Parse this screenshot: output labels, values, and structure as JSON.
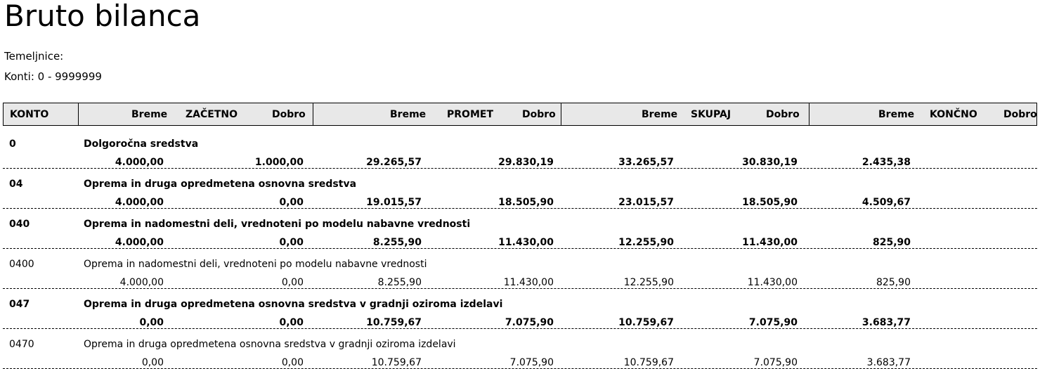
{
  "page": {
    "title": "Bruto bilanca",
    "temeljnice": "Temeljnice:",
    "konti": "Konti: 0 - 9999999"
  },
  "header": {
    "konto": "KONTO",
    "zacetno": {
      "breme": "Breme",
      "label": "ZAČETNO",
      "dobro": "Dobro"
    },
    "promet": {
      "breme": "Breme",
      "label": "PROMET",
      "dobro": "Dobro"
    },
    "skupaj": {
      "breme": "Breme",
      "label": "SKUPAJ",
      "dobro": "Dobro"
    },
    "koncno": {
      "breme": "Breme",
      "label": "KONČNO",
      "dobro": "Dobro"
    }
  },
  "rows": [
    {
      "konto": "0",
      "naziv": "Dolgoročna sredstva",
      "bold": true,
      "zacetno_breme": "4.000,00",
      "zacetno_dobro": "1.000,00",
      "promet_breme": "29.265,57",
      "promet_dobro": "29.830,19",
      "skupaj_breme": "33.265,57",
      "skupaj_dobro": "30.830,19",
      "koncno_breme": "2.435,38",
      "koncno_dobro": ""
    },
    {
      "konto": "04",
      "naziv": "Oprema in druga opredmetena osnovna sredstva",
      "bold": true,
      "zacetno_breme": "4.000,00",
      "zacetno_dobro": "0,00",
      "promet_breme": "19.015,57",
      "promet_dobro": "18.505,90",
      "skupaj_breme": "23.015,57",
      "skupaj_dobro": "18.505,90",
      "koncno_breme": "4.509,67",
      "koncno_dobro": ""
    },
    {
      "konto": "040",
      "naziv": "Oprema in nadomestni deli, vrednoteni po modelu nabavne vrednosti",
      "bold": true,
      "zacetno_breme": "4.000,00",
      "zacetno_dobro": "0,00",
      "promet_breme": "8.255,90",
      "promet_dobro": "11.430,00",
      "skupaj_breme": "12.255,90",
      "skupaj_dobro": "11.430,00",
      "koncno_breme": "825,90",
      "koncno_dobro": ""
    },
    {
      "konto": "0400",
      "naziv": "Oprema in nadomestni deli, vrednoteni po modelu nabavne vrednosti",
      "bold": false,
      "zacetno_breme": "4.000,00",
      "zacetno_dobro": "0,00",
      "promet_breme": "8.255,90",
      "promet_dobro": "11.430,00",
      "skupaj_breme": "12.255,90",
      "skupaj_dobro": "11.430,00",
      "koncno_breme": "825,90",
      "koncno_dobro": ""
    },
    {
      "konto": "047",
      "naziv": "Oprema in druga opredmetena osnovna sredstva v gradnji oziroma izdelavi",
      "bold": true,
      "zacetno_breme": "0,00",
      "zacetno_dobro": "0,00",
      "promet_breme": "10.759,67",
      "promet_dobro": "7.075,90",
      "skupaj_breme": "10.759,67",
      "skupaj_dobro": "7.075,90",
      "koncno_breme": "3.683,77",
      "koncno_dobro": ""
    },
    {
      "konto": "0470",
      "naziv": "Oprema in druga opredmetena osnovna sredstva v gradnji oziroma izdelavi",
      "bold": false,
      "zacetno_breme": "0,00",
      "zacetno_dobro": "0,00",
      "promet_breme": "10.759,67",
      "promet_dobro": "7.075,90",
      "skupaj_breme": "10.759,67",
      "skupaj_dobro": "7.075,90",
      "koncno_breme": "3.683,77",
      "koncno_dobro": ""
    }
  ]
}
